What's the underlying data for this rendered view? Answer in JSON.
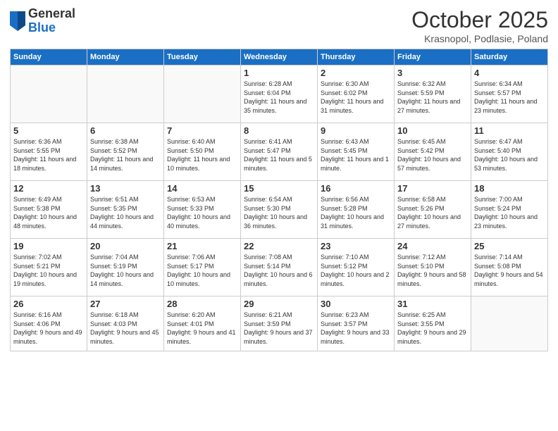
{
  "header": {
    "logo": {
      "line1": "General",
      "line2": "Blue"
    },
    "title": "October 2025",
    "subtitle": "Krasnopol, Podlasie, Poland"
  },
  "days_of_week": [
    "Sunday",
    "Monday",
    "Tuesday",
    "Wednesday",
    "Thursday",
    "Friday",
    "Saturday"
  ],
  "weeks": [
    [
      {
        "day": "",
        "info": ""
      },
      {
        "day": "",
        "info": ""
      },
      {
        "day": "",
        "info": ""
      },
      {
        "day": "1",
        "info": "Sunrise: 6:28 AM\nSunset: 6:04 PM\nDaylight: 11 hours\nand 35 minutes."
      },
      {
        "day": "2",
        "info": "Sunrise: 6:30 AM\nSunset: 6:02 PM\nDaylight: 11 hours\nand 31 minutes."
      },
      {
        "day": "3",
        "info": "Sunrise: 6:32 AM\nSunset: 5:59 PM\nDaylight: 11 hours\nand 27 minutes."
      },
      {
        "day": "4",
        "info": "Sunrise: 6:34 AM\nSunset: 5:57 PM\nDaylight: 11 hours\nand 23 minutes."
      }
    ],
    [
      {
        "day": "5",
        "info": "Sunrise: 6:36 AM\nSunset: 5:55 PM\nDaylight: 11 hours\nand 18 minutes."
      },
      {
        "day": "6",
        "info": "Sunrise: 6:38 AM\nSunset: 5:52 PM\nDaylight: 11 hours\nand 14 minutes."
      },
      {
        "day": "7",
        "info": "Sunrise: 6:40 AM\nSunset: 5:50 PM\nDaylight: 11 hours\nand 10 minutes."
      },
      {
        "day": "8",
        "info": "Sunrise: 6:41 AM\nSunset: 5:47 PM\nDaylight: 11 hours\nand 5 minutes."
      },
      {
        "day": "9",
        "info": "Sunrise: 6:43 AM\nSunset: 5:45 PM\nDaylight: 11 hours\nand 1 minute."
      },
      {
        "day": "10",
        "info": "Sunrise: 6:45 AM\nSunset: 5:42 PM\nDaylight: 10 hours\nand 57 minutes."
      },
      {
        "day": "11",
        "info": "Sunrise: 6:47 AM\nSunset: 5:40 PM\nDaylight: 10 hours\nand 53 minutes."
      }
    ],
    [
      {
        "day": "12",
        "info": "Sunrise: 6:49 AM\nSunset: 5:38 PM\nDaylight: 10 hours\nand 48 minutes."
      },
      {
        "day": "13",
        "info": "Sunrise: 6:51 AM\nSunset: 5:35 PM\nDaylight: 10 hours\nand 44 minutes."
      },
      {
        "day": "14",
        "info": "Sunrise: 6:53 AM\nSunset: 5:33 PM\nDaylight: 10 hours\nand 40 minutes."
      },
      {
        "day": "15",
        "info": "Sunrise: 6:54 AM\nSunset: 5:30 PM\nDaylight: 10 hours\nand 36 minutes."
      },
      {
        "day": "16",
        "info": "Sunrise: 6:56 AM\nSunset: 5:28 PM\nDaylight: 10 hours\nand 31 minutes."
      },
      {
        "day": "17",
        "info": "Sunrise: 6:58 AM\nSunset: 5:26 PM\nDaylight: 10 hours\nand 27 minutes."
      },
      {
        "day": "18",
        "info": "Sunrise: 7:00 AM\nSunset: 5:24 PM\nDaylight: 10 hours\nand 23 minutes."
      }
    ],
    [
      {
        "day": "19",
        "info": "Sunrise: 7:02 AM\nSunset: 5:21 PM\nDaylight: 10 hours\nand 19 minutes."
      },
      {
        "day": "20",
        "info": "Sunrise: 7:04 AM\nSunset: 5:19 PM\nDaylight: 10 hours\nand 14 minutes."
      },
      {
        "day": "21",
        "info": "Sunrise: 7:06 AM\nSunset: 5:17 PM\nDaylight: 10 hours\nand 10 minutes."
      },
      {
        "day": "22",
        "info": "Sunrise: 7:08 AM\nSunset: 5:14 PM\nDaylight: 10 hours\nand 6 minutes."
      },
      {
        "day": "23",
        "info": "Sunrise: 7:10 AM\nSunset: 5:12 PM\nDaylight: 10 hours\nand 2 minutes."
      },
      {
        "day": "24",
        "info": "Sunrise: 7:12 AM\nSunset: 5:10 PM\nDaylight: 9 hours\nand 58 minutes."
      },
      {
        "day": "25",
        "info": "Sunrise: 7:14 AM\nSunset: 5:08 PM\nDaylight: 9 hours\nand 54 minutes."
      }
    ],
    [
      {
        "day": "26",
        "info": "Sunrise: 6:16 AM\nSunset: 4:06 PM\nDaylight: 9 hours\nand 49 minutes."
      },
      {
        "day": "27",
        "info": "Sunrise: 6:18 AM\nSunset: 4:03 PM\nDaylight: 9 hours\nand 45 minutes."
      },
      {
        "day": "28",
        "info": "Sunrise: 6:20 AM\nSunset: 4:01 PM\nDaylight: 9 hours\nand 41 minutes."
      },
      {
        "day": "29",
        "info": "Sunrise: 6:21 AM\nSunset: 3:59 PM\nDaylight: 9 hours\nand 37 minutes."
      },
      {
        "day": "30",
        "info": "Sunrise: 6:23 AM\nSunset: 3:57 PM\nDaylight: 9 hours\nand 33 minutes."
      },
      {
        "day": "31",
        "info": "Sunrise: 6:25 AM\nSunset: 3:55 PM\nDaylight: 9 hours\nand 29 minutes."
      },
      {
        "day": "",
        "info": ""
      }
    ]
  ]
}
